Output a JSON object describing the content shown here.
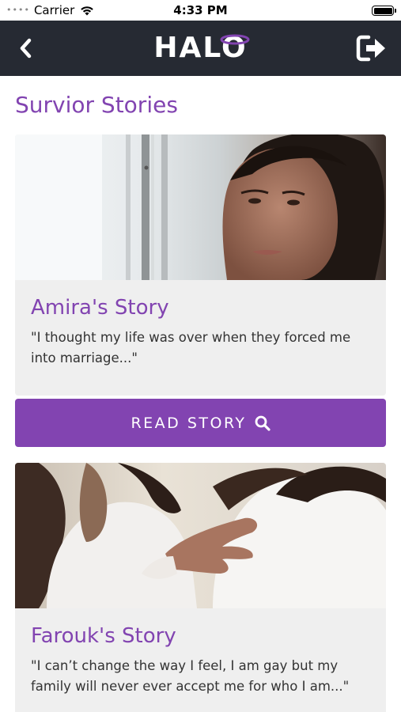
{
  "status_bar": {
    "signal": "••••",
    "carrier": "Carrier",
    "time": "4:33 PM"
  },
  "nav": {
    "logo": "HALO",
    "back_icon": "chevron-left-icon",
    "logout_icon": "sign-out-icon"
  },
  "page": {
    "title": "Survior Stories"
  },
  "stories": [
    {
      "title": "Amira's Story",
      "quote": "\"I thought my life was over when they forced me into marriage...\"",
      "button_label": "READ STORY"
    },
    {
      "title": "Farouk's Story",
      "quote": "\"I can’t change the way I feel, I am gay but my family will never ever accept me for who I am...\""
    }
  ],
  "colors": {
    "accent": "#8244b1",
    "nav_background": "#262a33",
    "card_background": "#efefef"
  }
}
